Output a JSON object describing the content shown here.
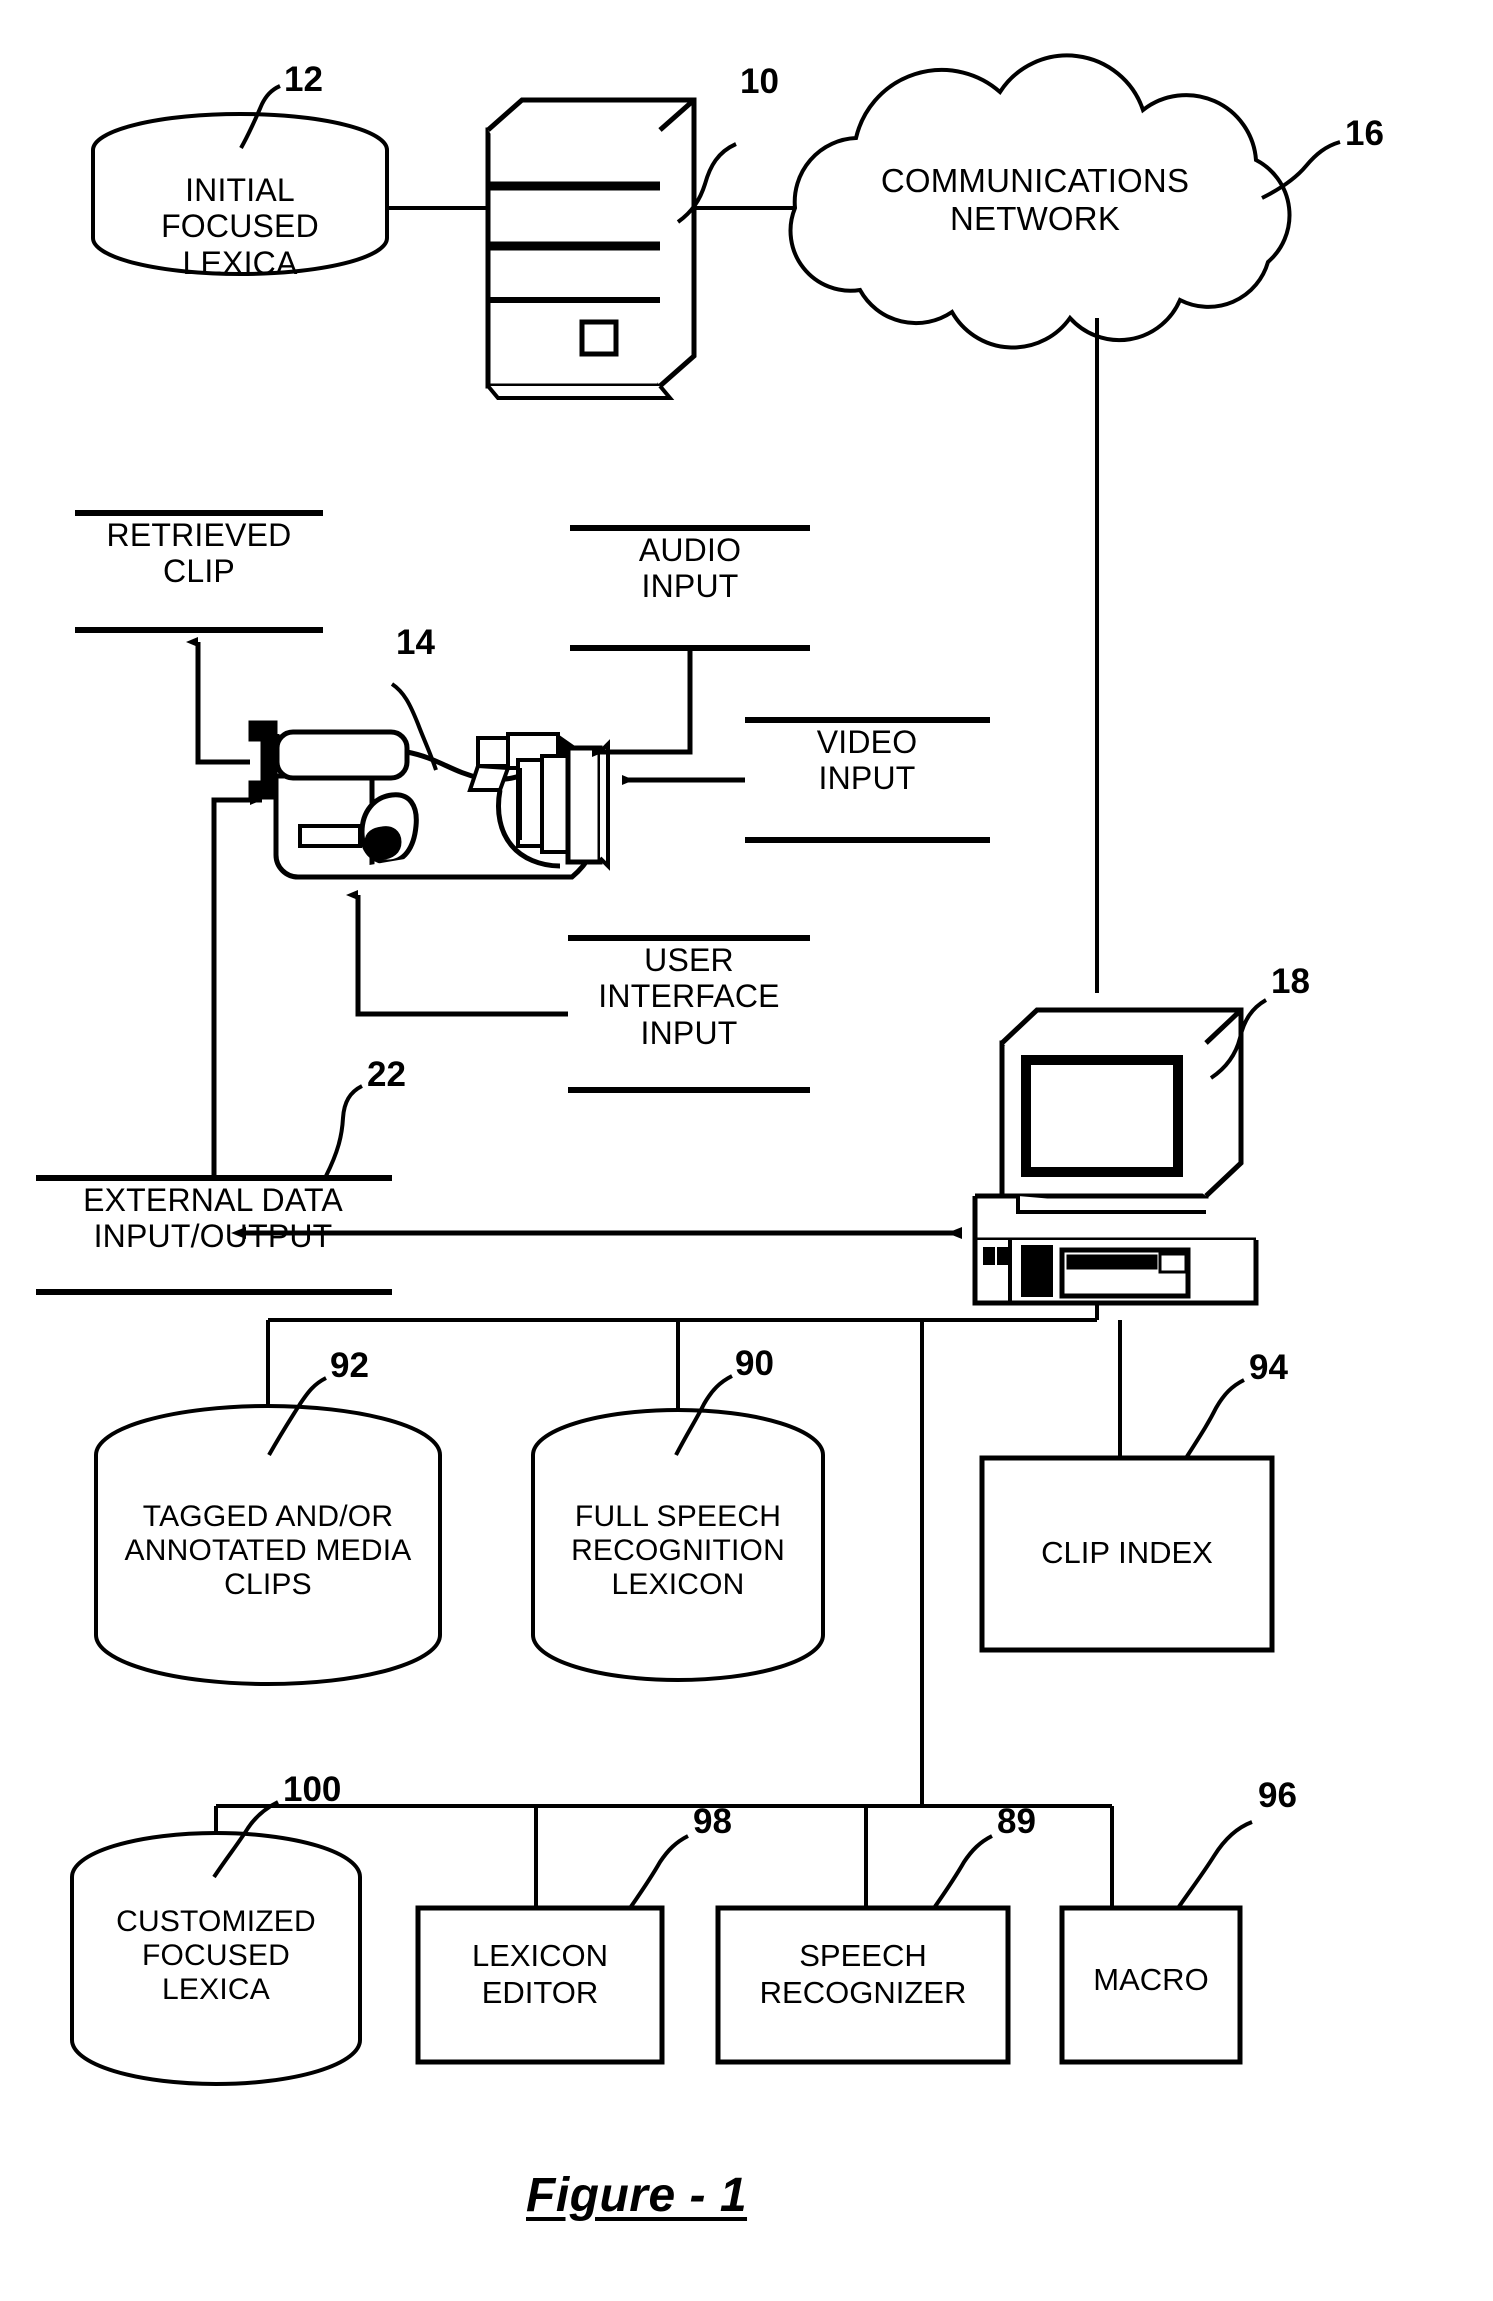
{
  "figure": {
    "caption": "Figure - 1",
    "type": "patent-block-diagram"
  },
  "nodes": {
    "initial_focused_lexica": {
      "label": "INITIAL\nFOCUSED\nLEXICA",
      "ref": "12",
      "shape": "cylinder"
    },
    "server": {
      "label": "",
      "ref": "10",
      "shape": "server-tower"
    },
    "communications_network": {
      "label": "COMMUNICATIONS\nNETWORK",
      "ref": "16",
      "shape": "cloud"
    },
    "camcorder": {
      "label": "",
      "ref": "14",
      "shape": "camcorder"
    },
    "workstation": {
      "label": "",
      "ref": "18",
      "shape": "desktop-computer"
    },
    "tagged_media_clips": {
      "label": "TAGGED AND/OR\nANNOTATED MEDIA\nCLIPS",
      "ref": "92",
      "shape": "cylinder"
    },
    "full_speech_lexicon": {
      "label": "FULL SPEECH\nRECOGNITION\nLEXICON",
      "ref": "90",
      "shape": "cylinder"
    },
    "clip_index": {
      "label": "CLIP INDEX",
      "ref": "94",
      "shape": "rect"
    },
    "customized_focused_lexica": {
      "label": "CUSTOMIZED\nFOCUSED\nLEXICA",
      "ref": "100",
      "shape": "cylinder"
    },
    "lexicon_editor": {
      "label": "LEXICON\nEDITOR",
      "ref": "98",
      "shape": "rect"
    },
    "speech_recognizer": {
      "label": "SPEECH\nRECOGNIZER",
      "ref": "89",
      "shape": "rect"
    },
    "macro": {
      "label": "MACRO",
      "ref": "96",
      "shape": "rect"
    }
  },
  "io_labels": {
    "retrieved_clip": {
      "label": "RETRIEVED\nCLIP",
      "style": "rules-above-below"
    },
    "audio_input": {
      "label": "AUDIO\nINPUT",
      "style": "rules-above-below"
    },
    "video_input": {
      "label": "VIDEO\nINPUT",
      "style": "rules-above-below"
    },
    "user_interface_input": {
      "label": "USER\nINTERFACE\nINPUT",
      "style": "rules-above-below"
    },
    "external_data_io": {
      "label": "EXTERNAL DATA\nINPUT/OUTPUT",
      "ref": "22",
      "style": "rules-above-below"
    }
  },
  "colors": {
    "ink": "#000000",
    "paper": "#ffffff"
  }
}
